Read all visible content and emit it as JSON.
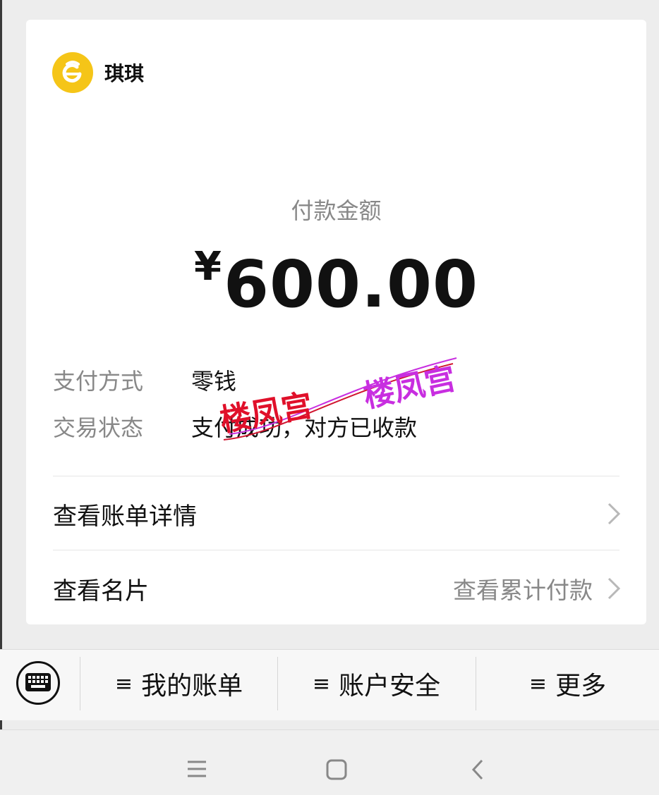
{
  "payee": {
    "name": "琪琪",
    "logo_icon": "payee-logo-icon",
    "logo_color": "#f5c518"
  },
  "payment": {
    "amount_label": "付款金额",
    "currency": "¥",
    "amount": "600.00"
  },
  "details": [
    {
      "key": "支付方式",
      "value": "零钱"
    },
    {
      "key": "交易状态",
      "value": "支付成功，对方已收款"
    }
  ],
  "links": {
    "bill_details": "查看账单详情",
    "view_card": "查看名片",
    "cumulative_payments": "查看累计付款"
  },
  "watermark": {
    "text": "楼凤宫",
    "colors": [
      "#e0102a",
      "#c82ee0"
    ]
  },
  "bottom_menu": {
    "keyboard_icon": "keyboard-icon",
    "items": [
      {
        "icon": "≡",
        "label": "我的账单"
      },
      {
        "icon": "≡",
        "label": "账户安全"
      },
      {
        "icon": "≡",
        "label": "更多"
      }
    ]
  },
  "nav": {
    "icons": [
      "menu-icon",
      "home-icon",
      "back-icon"
    ]
  }
}
